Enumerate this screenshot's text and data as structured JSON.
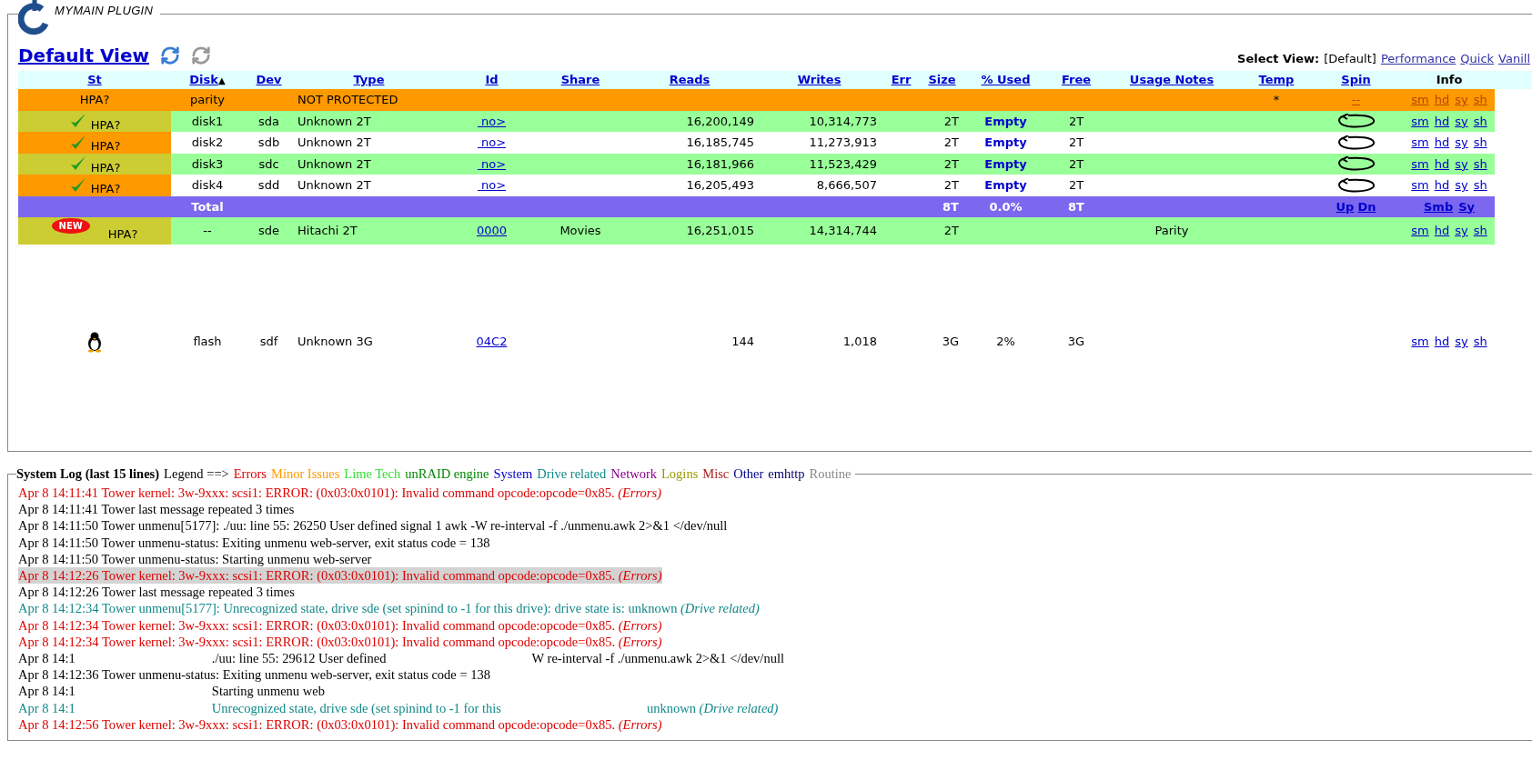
{
  "plugin": {
    "title": "MYMAIN PLUGIN"
  },
  "view": {
    "title": "Default View",
    "select_label": "Select View:",
    "options": [
      {
        "label": "[Default]",
        "selected": true
      },
      {
        "label": "Performance",
        "selected": false
      },
      {
        "label": "Quick",
        "selected": false
      },
      {
        "label": "Vanill",
        "selected": false
      }
    ]
  },
  "table": {
    "columns": [
      {
        "label": "St",
        "link": true
      },
      {
        "label": "Disk",
        "link": true,
        "sort_indicator": "▲"
      },
      {
        "label": "Dev",
        "link": true
      },
      {
        "label": "Type",
        "link": true
      },
      {
        "label": "Id",
        "link": true
      },
      {
        "label": "Share",
        "link": true
      },
      {
        "label": "Reads",
        "link": true
      },
      {
        "label": "Writes",
        "link": true
      },
      {
        "label": "Err",
        "link": true
      },
      {
        "label": "Size",
        "link": true
      },
      {
        "label": "% Used",
        "link": true
      },
      {
        "label": "Free",
        "link": true
      },
      {
        "label": "Usage Notes",
        "link": true
      },
      {
        "label": "Temp",
        "link": true
      },
      {
        "label": "Spin",
        "link": true
      },
      {
        "label": "Info",
        "link": false
      }
    ],
    "rows": [
      {
        "kind": "parity",
        "color": "#ff9900",
        "status": {
          "color": "#ff9900",
          "check": false,
          "label": "HPA?"
        },
        "disk": "parity",
        "type": "NOT PROTECTED",
        "temp": "*",
        "spin": {
          "kind": "links",
          "labels": [
            "--"
          ]
        },
        "info": [
          "sm",
          "hd",
          "sy",
          "sh"
        ]
      },
      {
        "kind": "disk",
        "color": "#99ff99",
        "status": {
          "color": "#cccc33",
          "check": true,
          "label": "HPA?"
        },
        "disk": "disk1",
        "dev": "sda",
        "type": "Unknown 2T",
        "id": " no>",
        "reads": "16,200,149",
        "writes": "10,314,773",
        "size": "2T",
        "used": "Empty",
        "free": "2T",
        "spin": {
          "kind": "icon"
        },
        "info": [
          "sm",
          "hd",
          "sy",
          "sh"
        ]
      },
      {
        "kind": "disk",
        "color": "#ffffff",
        "status": {
          "color": "#ff9900",
          "check": true,
          "label": "HPA?"
        },
        "disk": "disk2",
        "dev": "sdb",
        "type": "Unknown 2T",
        "id": " no>",
        "reads": "16,185,745",
        "writes": "11,273,913",
        "size": "2T",
        "used": "Empty",
        "free": "2T",
        "spin": {
          "kind": "icon"
        },
        "info": [
          "sm",
          "hd",
          "sy",
          "sh"
        ]
      },
      {
        "kind": "disk",
        "color": "#99ff99",
        "status": {
          "color": "#cccc33",
          "check": true,
          "label": "HPA?"
        },
        "disk": "disk3",
        "dev": "sdc",
        "type": "Unknown 2T",
        "id": " no>",
        "reads": "16,181,966",
        "writes": "11,523,429",
        "size": "2T",
        "used": "Empty",
        "free": "2T",
        "spin": {
          "kind": "icon"
        },
        "info": [
          "sm",
          "hd",
          "sy",
          "sh"
        ]
      },
      {
        "kind": "disk",
        "color": "#ffffff",
        "status": {
          "color": "#ff9900",
          "check": true,
          "label": "HPA?"
        },
        "disk": "disk4",
        "dev": "sdd",
        "type": "Unknown 2T",
        "id": " no>",
        "reads": "16,205,493",
        "writes": "8,666,507",
        "size": "2T",
        "used": "Empty",
        "free": "2T",
        "spin": {
          "kind": "icon"
        },
        "info": [
          "sm",
          "hd",
          "sy",
          "sh"
        ]
      },
      {
        "kind": "total",
        "color": "#7b68ee",
        "disk": "Total",
        "size": "8T",
        "used": "0.0%",
        "free": "8T",
        "spin": {
          "kind": "links",
          "labels": [
            "Up",
            "Dn"
          ]
        },
        "info": [
          "Smb",
          "Sy"
        ]
      },
      {
        "kind": "new",
        "color": "#99ff99",
        "status": {
          "color": "#cccc33",
          "check": false,
          "badge": "NEW",
          "label": "HPA?"
        },
        "disk": "--",
        "dev": "sde",
        "type": "Hitachi 2T",
        "id": "0000",
        "share": "Movies",
        "reads": "16,251,015",
        "writes": "14,314,744",
        "size": "2T",
        "notes": "Parity",
        "info": [
          "sm",
          "hd",
          "sy",
          "sh"
        ]
      },
      {
        "kind": "flash",
        "color": "#ffffff",
        "disk": "flash",
        "dev": "sdf",
        "type": "Unknown 3G",
        "id": "04C2",
        "reads": "144",
        "writes": "1,018",
        "size": "3G",
        "used": "2%",
        "free": "3G",
        "info": [
          "sm",
          "hd",
          "sy",
          "sh"
        ]
      }
    ]
  },
  "log": {
    "title": "System Log (last 15 lines)",
    "legend_label": "Legend ==>",
    "legend": [
      {
        "label": "Errors",
        "color": "#dd0000"
      },
      {
        "label": "Minor Issues",
        "color": "#ff9900"
      },
      {
        "label": "Lime Tech",
        "color": "#33dd33"
      },
      {
        "label": "unRAID engine",
        "color": "#008800"
      },
      {
        "label": "System",
        "color": "#0000cc"
      },
      {
        "label": "Drive related",
        "color": "#118888"
      },
      {
        "label": "Network",
        "color": "#880088"
      },
      {
        "label": "Logins",
        "color": "#999900"
      },
      {
        "label": "Misc",
        "color": "#aa2222"
      },
      {
        "label": "Other",
        "color": "#000088"
      },
      {
        "label": "emhttp",
        "color": "#000066"
      },
      {
        "label": "Routine",
        "color": "#888888"
      }
    ],
    "lines": [
      {
        "parts": [
          "Apr 8 14:11:41 Tower kernel: 3w-9xxx: scsi1: ERROR: (0x03:0x0101): Invalid command opcode:opcode=0x85."
        ],
        "tag": "(Errors)",
        "color": "#dd0000",
        "highlighted": false
      },
      {
        "parts": [
          "Apr 8 14:11:41 Tower last message repeated 3 times"
        ],
        "color": "#000000",
        "highlighted": false
      },
      {
        "parts": [
          "Apr 8 14:11:50 Tower unmenu[5177]: ./uu: line 55: 26250 User defined signal 1 awk -W re-interval -f ./unmenu.awk 2>&1 </dev/null"
        ],
        "color": "#000000",
        "highlighted": false
      },
      {
        "parts": [
          "Apr 8 14:11:50 Tower unmenu-status: Exiting unmenu web-server, exit status code = 138"
        ],
        "color": "#000000",
        "highlighted": false
      },
      {
        "parts": [
          "Apr 8 14:11:50 Tower unmenu-status: Starting unmenu web-server"
        ],
        "color": "#000000",
        "highlighted": false
      },
      {
        "parts": [
          "Apr 8 14:12:26 Tower kernel: 3w-9xxx: scsi1: ERROR: (0x03:0x0101): Invalid command opcode:opcode=0x85."
        ],
        "tag": "(Errors)",
        "color": "#dd0000",
        "highlighted": true
      },
      {
        "parts": [
          "Apr 8 14:12:26 Tower last message repeated 3 times"
        ],
        "color": "#000000",
        "highlighted": false
      },
      {
        "parts": [
          "Apr 8 14:12:34 Tower unmenu[5177]: Unrecognized state, drive sde (set spinind to -1 for this drive): drive state is: unknown"
        ],
        "tag": "(Drive related)",
        "color": "#118888",
        "highlighted": false
      },
      {
        "parts": [
          "Apr 8 14:12:34 Tower kernel: 3w-9xxx: scsi1: ERROR: (0x03:0x0101): Invalid command opcode:opcode=0x85."
        ],
        "tag": "(Errors)",
        "color": "#dd0000",
        "highlighted": false
      },
      {
        "parts": [
          "Apr 8 14:12:34 Tower kernel: 3w-9xxx: scsi1: ERROR: (0x03:0x0101): Invalid command opcode:opcode=0x85."
        ],
        "tag": "(Errors)",
        "color": "#dd0000",
        "highlighted": false
      },
      {
        "parts": [
          "Apr 8 14:1",
          "./uu: line 55: 29612 User defined",
          "W re-interval -f ./unmenu.awk 2>&1 </dev/null"
        ],
        "color": "#000000",
        "highlighted": false
      },
      {
        "parts": [
          "Apr 8 14:12:36 Tower unmenu-status: Exiting unmenu web-server, exit status code = 138"
        ],
        "color": "#000000",
        "highlighted": false
      },
      {
        "parts": [
          "Apr 8 14:1",
          "Starting unmenu web"
        ],
        "color": "#000000",
        "highlighted": false
      },
      {
        "parts": [
          "Apr 8 14:1",
          "Unrecognized state, drive sde (set spinind to -1 for this",
          "unknown"
        ],
        "tag": "(Drive related)",
        "color": "#118888",
        "highlighted": false
      },
      {
        "parts": [
          "Apr 8 14:12:56 Tower kernel: 3w-9xxx: scsi1: ERROR: (0x03:0x0101): Invalid command opcode:opcode=0x85."
        ],
        "tag": "(Errors)",
        "color": "#dd0000",
        "highlighted": false
      }
    ]
  }
}
